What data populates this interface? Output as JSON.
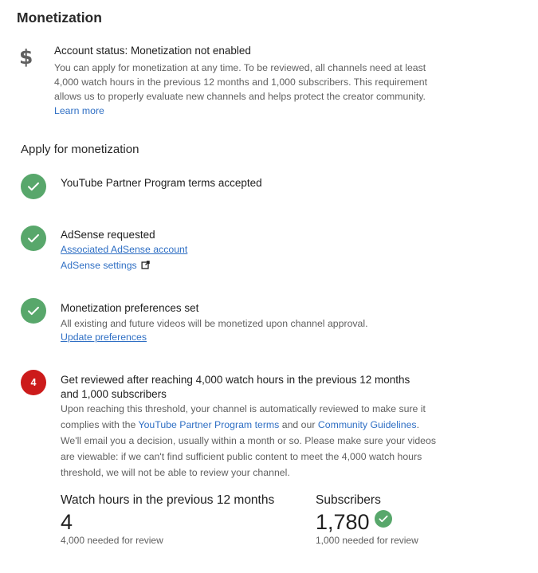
{
  "page": {
    "title": "Monetization"
  },
  "account_status": {
    "icon": "dollar-icon",
    "heading": "Account status: Monetization not enabled",
    "description": "You can apply for monetization at any time. To be reviewed, all channels need at least 4,000 watch hours in the previous 12 months and 1,000 subscribers. This requirement allows us to properly evaluate new channels and helps protect the creator community.",
    "learn_more": "Learn more"
  },
  "apply": {
    "heading": "Apply for monetization",
    "steps": [
      {
        "status": "done",
        "title": "YouTube Partner Program terms accepted"
      },
      {
        "status": "done",
        "title": "AdSense requested",
        "links": [
          "Associated AdSense account",
          "AdSense settings"
        ]
      },
      {
        "status": "done",
        "title": "Monetization preferences set",
        "text": "All existing and future videos will be monetized upon channel approval.",
        "links": [
          "Update preferences"
        ]
      },
      {
        "status": "pending",
        "number": "4",
        "title_line1": "Get reviewed after reaching 4,000 watch hours in the previous 12 months",
        "title_line2": "and 1,000 subscribers",
        "text_part1": "Upon reaching this threshold, your channel is automatically reviewed to make sure it complies with the ",
        "link1": "YouTube Partner Program terms",
        "text_part2": " and our ",
        "link2": "Community Guidelines",
        "text_part3": ". We'll email you a decision, usually within a month or so. Please make sure your videos are viewable: if we can't find sufficient public content to meet the 4,000 watch hours threshold, we will not be able to review your channel."
      }
    ]
  },
  "stats": {
    "watch_hours": {
      "label": "Watch hours in the previous 12 months",
      "value": "4",
      "note": "4,000 needed for review"
    },
    "subscribers": {
      "label": "Subscribers",
      "value": "1,780",
      "note": "1,000 needed for review",
      "met": true
    }
  },
  "colors": {
    "success": "#58a76b",
    "alert": "#cc1b1b",
    "link": "#2f6fc4",
    "secondary_text": "#606060"
  }
}
